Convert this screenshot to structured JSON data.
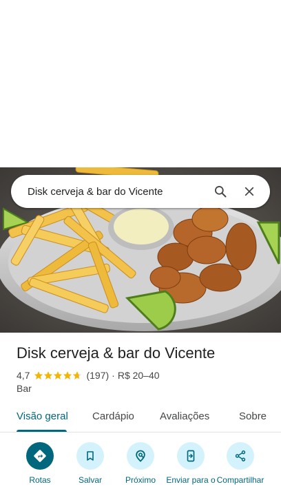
{
  "search": {
    "query": "Disk cerveja & bar do Vicente",
    "search_icon": "search-icon",
    "close_icon": "close-icon"
  },
  "hero": {
    "image": "photo of fries with sauce and fried fish with lime wedges"
  },
  "place": {
    "name": "Disk cerveja & bar do Vicente",
    "rating": "4,7",
    "stars_value": 4.7,
    "reviews": "(197)",
    "separator": "·",
    "price": "R$ 20–40",
    "category": "Bar"
  },
  "tabs": [
    {
      "label": "Visão geral",
      "active": true
    },
    {
      "label": "Cardápio",
      "active": false
    },
    {
      "label": "Avaliações",
      "active": false
    },
    {
      "label": "Sobre",
      "active": false
    }
  ],
  "actions": [
    {
      "label": "Rotas",
      "icon": "directions-icon"
    },
    {
      "label": "Salvar",
      "icon": "bookmark-icon"
    },
    {
      "label": "Próximo",
      "icon": "nearby-icon"
    },
    {
      "label": "Enviar para o",
      "icon": "send-to-phone-icon"
    },
    {
      "label": "Compartilhar",
      "icon": "share-icon"
    }
  ],
  "colors": {
    "accent": "#00677d",
    "action_bg": "#d4f2fb",
    "star": "#f4b400"
  }
}
